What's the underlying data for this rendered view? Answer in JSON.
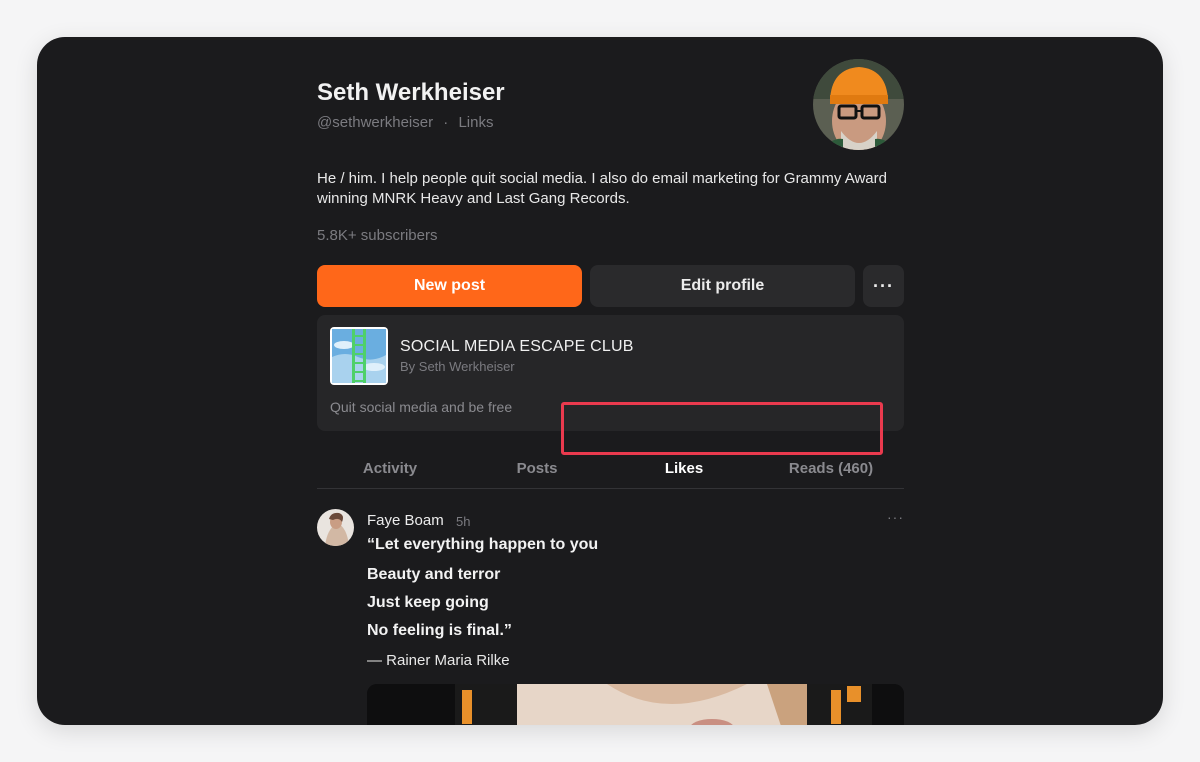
{
  "profile": {
    "name": "Seth Werkheiser",
    "handle": "@sethwerkheiser",
    "links_label": "Links",
    "separator": "·",
    "bio": "He / him. I help people quit social media. I also do email marketing for Grammy Award winning MNRK Heavy and Last Gang Records.",
    "subscribers": "5.8K+ subscribers"
  },
  "actions": {
    "new_post": "New post",
    "edit_profile": "Edit profile",
    "more": "···"
  },
  "publication": {
    "title": "SOCIAL MEDIA ESCAPE CLUB",
    "byline": "By Seth Werkheiser",
    "description": "Quit social media and be free"
  },
  "tabs": [
    {
      "label": "Activity",
      "active": false
    },
    {
      "label": "Posts",
      "active": false
    },
    {
      "label": "Likes",
      "active": true
    },
    {
      "label": "Reads (460)",
      "active": false
    }
  ],
  "post": {
    "author": "Faye Boam",
    "time": "5h",
    "menu": "···",
    "lines": [
      "“Let everything happen to you",
      "Beauty and terror",
      "Just keep going",
      "No feeling is final.”"
    ],
    "attribution": "— Rainer Maria Rilke"
  },
  "colors": {
    "accent": "#ff6719",
    "background": "#1b1b1d",
    "highlight": "#ea3a4e"
  }
}
